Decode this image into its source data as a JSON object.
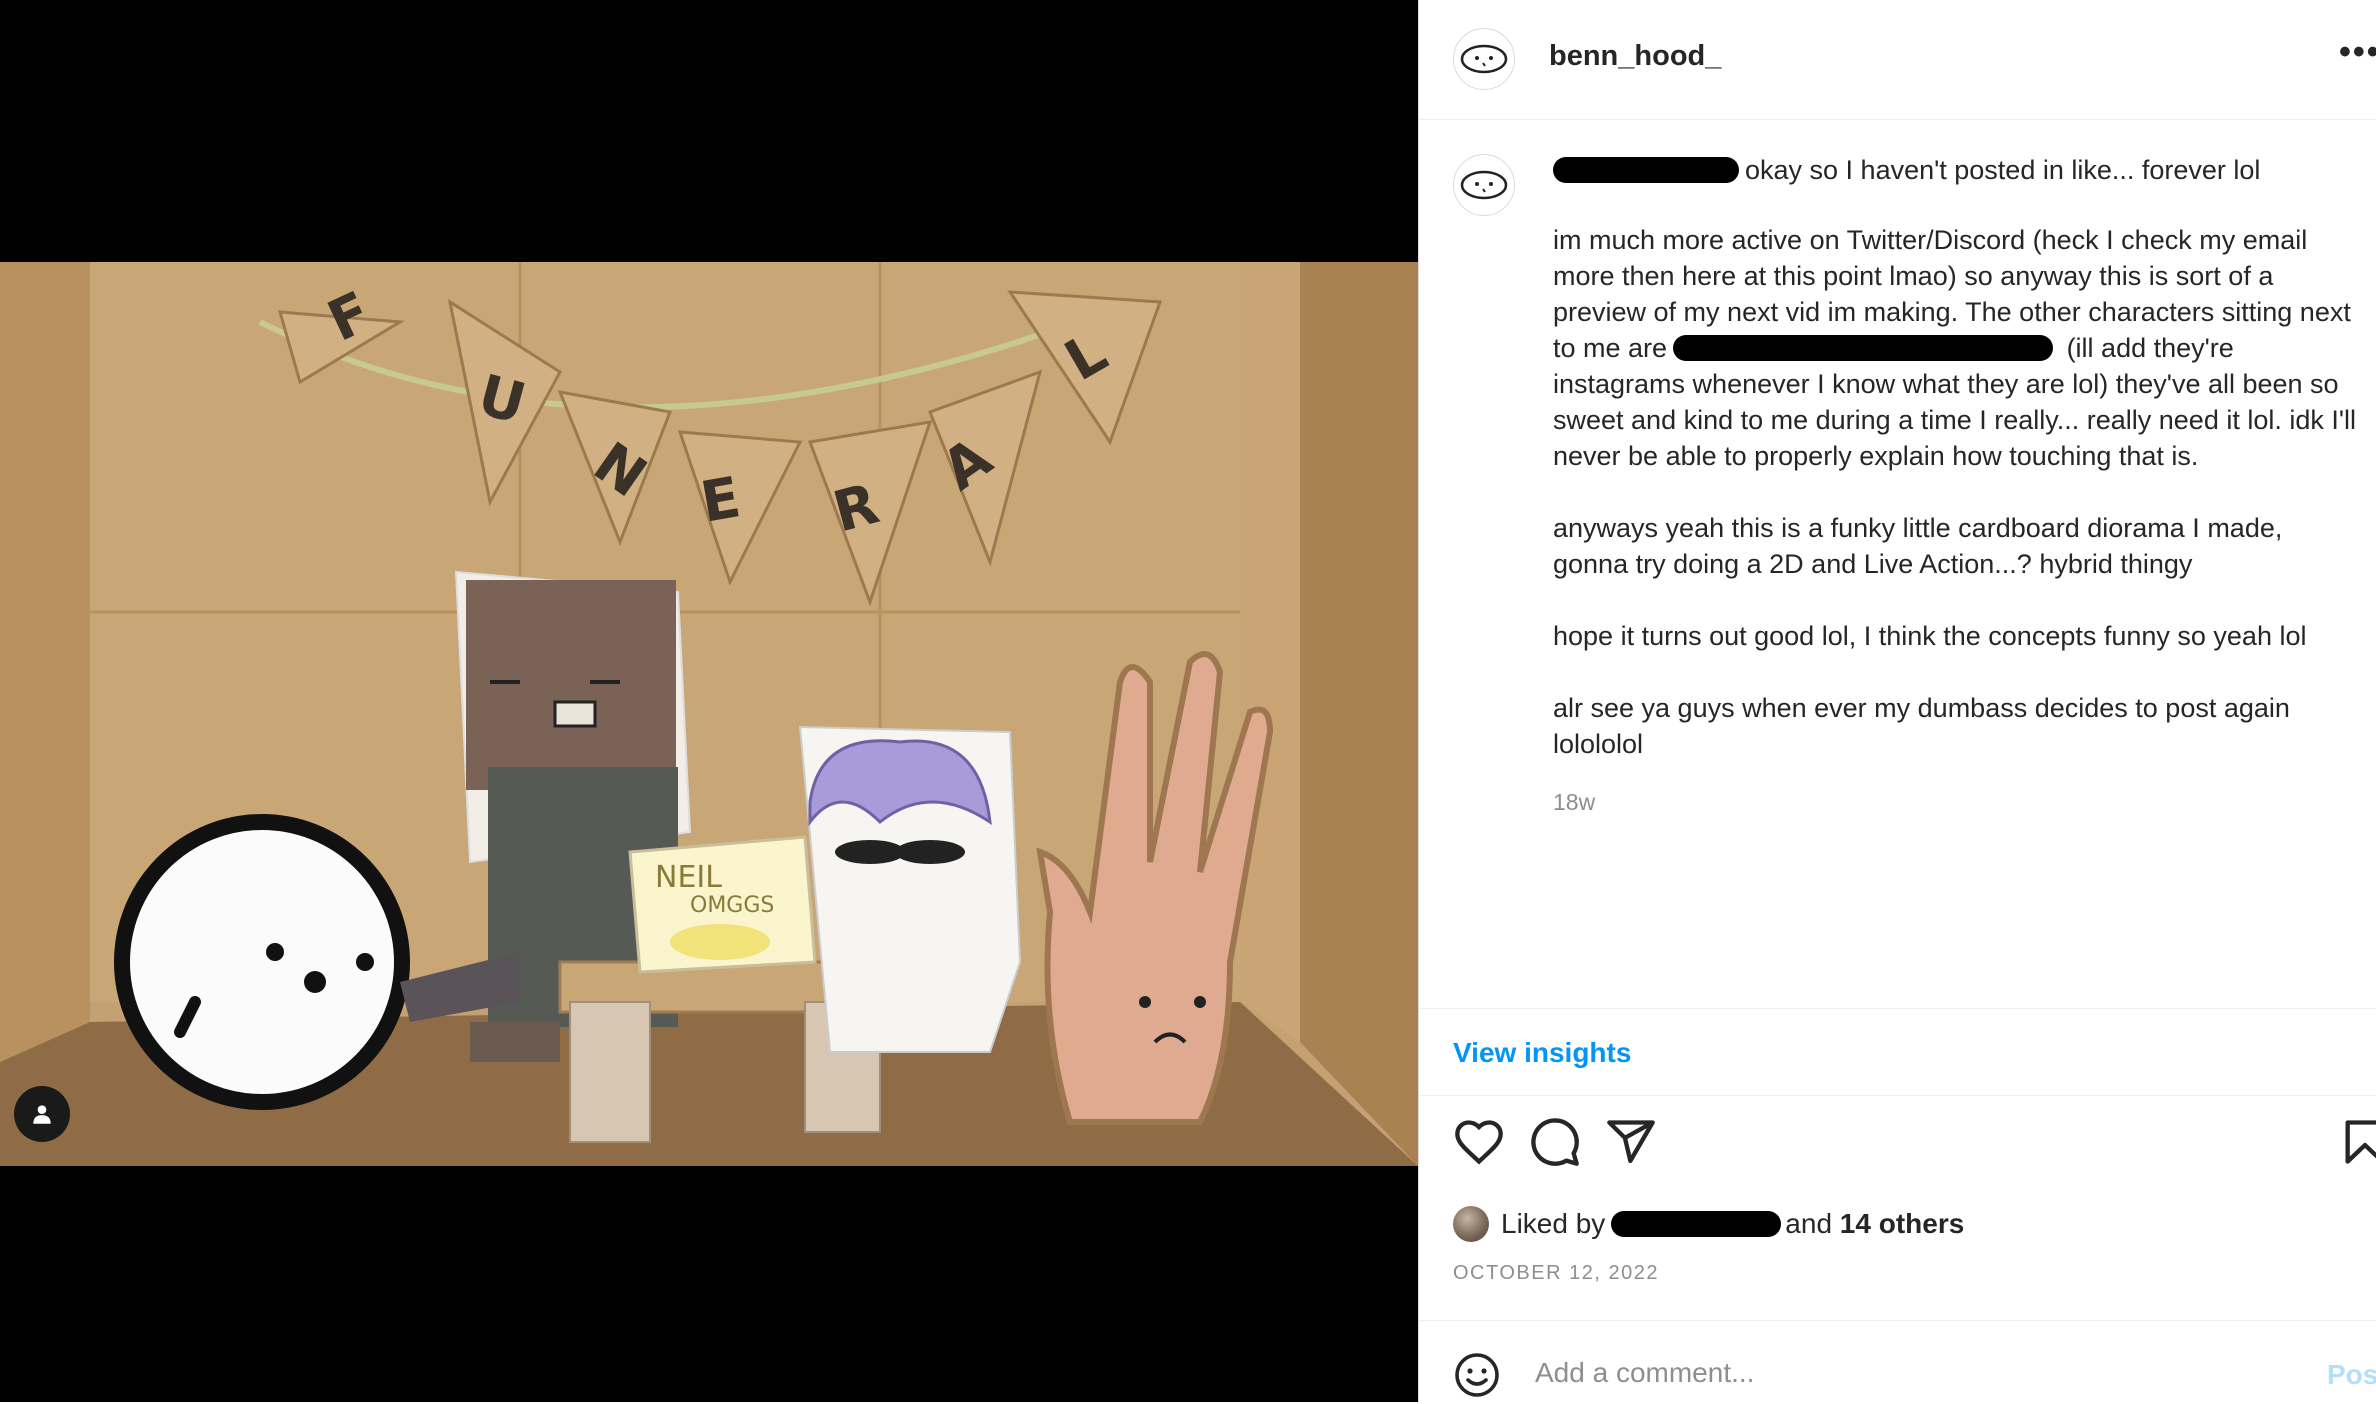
{
  "post": {
    "username": "benn_hood_",
    "more_label": "•••",
    "caption_paragraphs": [
      "im much more active on Twitter/Discord (heck I check my email more then here at this point lmao) so anyway this is sort of a preview of my next vid im making. The other characters sitting next to me are",
      "anyways yeah this is a funky little cardboard diorama I made, gonna try doing a 2D and Live Action...? hybrid thingy",
      "hope it turns out good lol, I think the concepts funny so yeah lol",
      "alr see ya guys when ever my dumbass decides to post again lolololol"
    ],
    "caption_first_line": "okay so I haven't posted in like... forever lol",
    "caption_para1_tail": " (ill add they're instagrams whenever I know what they are lol) they've all been so sweet and kind to me during a time I really... really need it lol. idk I'll never be able to properly explain how touching that is.",
    "caption_age": "18w",
    "insights_label": "View insights",
    "likes_prefix": "Liked by",
    "likes_and": "and",
    "likes_others": "14 others",
    "date": "OCTOBER 12, 2022",
    "comment_placeholder": "Add a comment...",
    "post_label": "Post"
  },
  "photo": {
    "banner_letters": [
      "F",
      "U",
      "N",
      "E",
      "R",
      "A",
      "L"
    ],
    "box_sign_text": [
      "NEIL",
      "OMGGS"
    ]
  },
  "colors": {
    "link_blue": "#0095f6",
    "post_disabled": "#b2dffc",
    "secondary_text": "#8e8e8e",
    "cardboard": "#c9a679"
  },
  "icons": {
    "like": "heart-icon",
    "comment": "comment-bubble-icon",
    "share": "paper-plane-icon",
    "save": "bookmark-icon",
    "emoji": "smiley-icon",
    "user_tags": "person-icon"
  }
}
